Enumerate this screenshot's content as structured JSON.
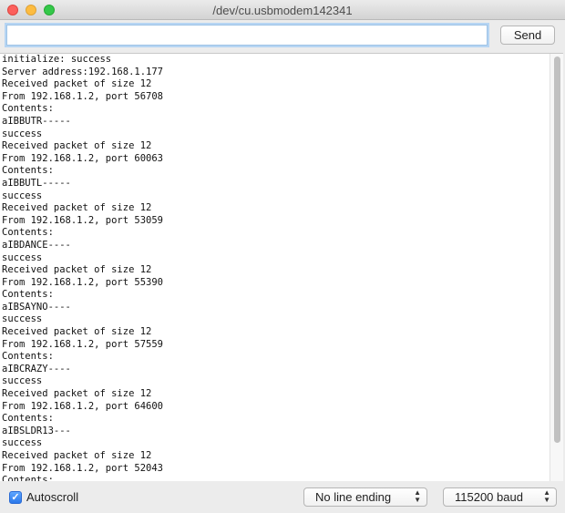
{
  "window": {
    "title": "/dev/cu.usbmodem142341"
  },
  "input": {
    "value": "",
    "send_label": "Send"
  },
  "output": {
    "lines": [
      "initialize: success",
      "Server address:192.168.1.177",
      "Received packet of size 12",
      "From 192.168.1.2, port 56708",
      "Contents:",
      "aIBBUTR-----",
      "success",
      "Received packet of size 12",
      "From 192.168.1.2, port 60063",
      "Contents:",
      "aIBBUTL-----",
      "success",
      "Received packet of size 12",
      "From 192.168.1.2, port 53059",
      "Contents:",
      "aIBDANCE----",
      "success",
      "Received packet of size 12",
      "From 192.168.1.2, port 55390",
      "Contents:",
      "aIBSAYNO----",
      "success",
      "Received packet of size 12",
      "From 192.168.1.2, port 57559",
      "Contents:",
      "aIBCRAZY----",
      "success",
      "Received packet of size 12",
      "From 192.168.1.2, port 64600",
      "Contents:",
      "aIBSLDR13---",
      "success",
      "Received packet of size 12",
      "From 192.168.1.2, port 52043",
      "Contents:"
    ]
  },
  "footer": {
    "autoscroll_label": "Autoscroll",
    "autoscroll_checked": true,
    "line_ending": "No line ending",
    "baud": "115200 baud"
  },
  "colors": {
    "focus_ring": "#b7d5f3",
    "checkbox_accent": "#2c78ea"
  }
}
